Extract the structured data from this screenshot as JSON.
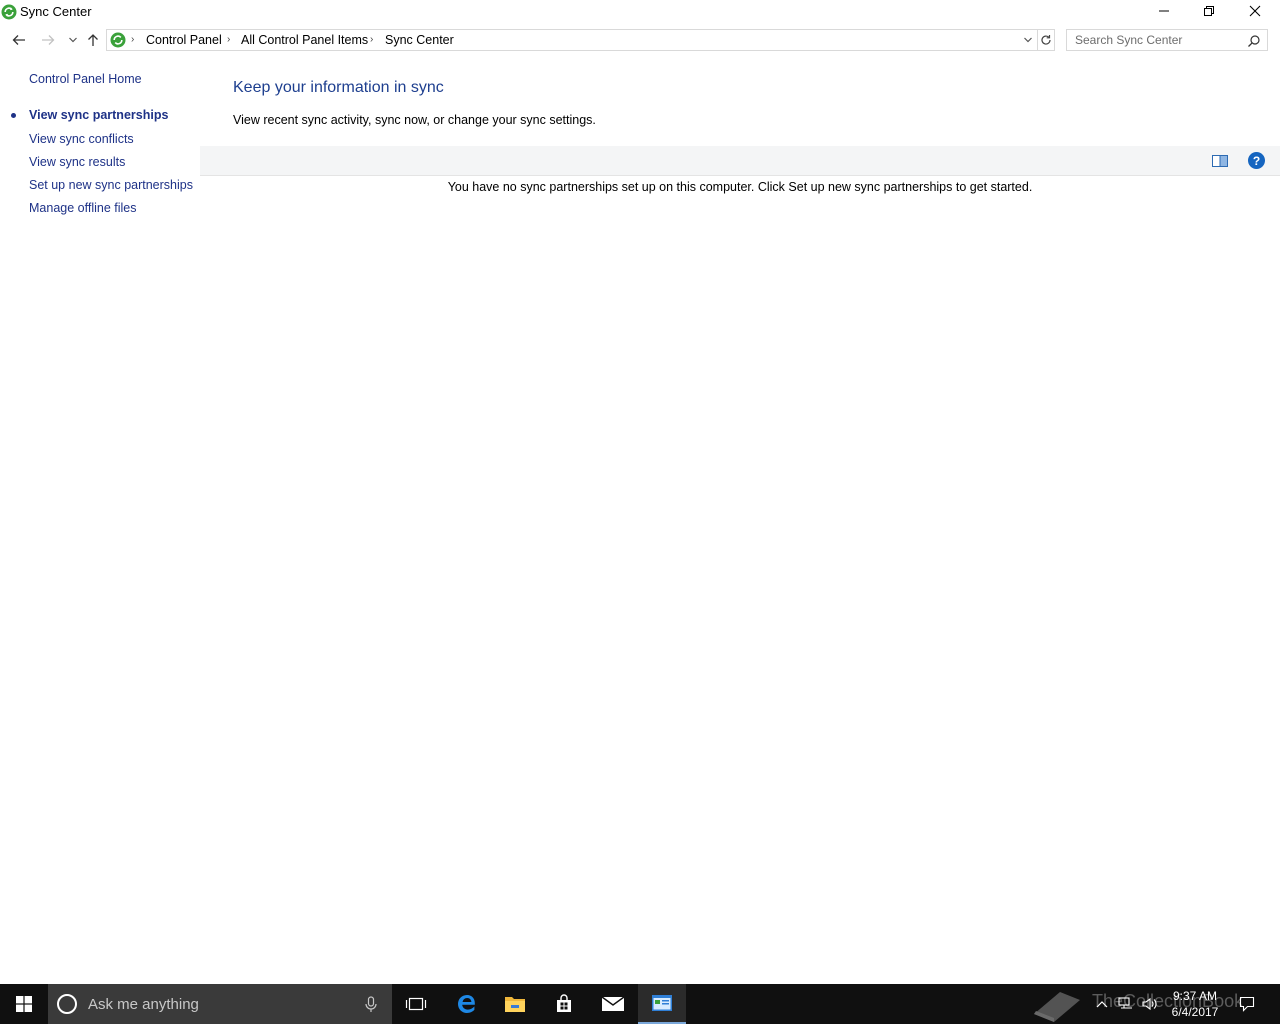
{
  "window": {
    "title": "Sync Center",
    "controls": {
      "minimize": "minimize-icon",
      "maximize": "restore-icon",
      "close": "close-icon"
    }
  },
  "address": {
    "breadcrumbs": [
      "Control Panel",
      "All Control Panel Items",
      "Sync Center"
    ],
    "search_placeholder": "Search Sync Center"
  },
  "sidebar": {
    "home": "Control Panel Home",
    "items": [
      {
        "label": "View sync partnerships",
        "active": true
      },
      {
        "label": "View sync conflicts",
        "active": false
      },
      {
        "label": "View sync results",
        "active": false
      },
      {
        "label": "Set up new sync partnerships",
        "active": false
      },
      {
        "label": "Manage offline files",
        "active": false
      }
    ]
  },
  "main": {
    "heading": "Keep your information in sync",
    "subtext": "View recent sync activity, sync now, or change your sync settings.",
    "help_label": "?",
    "empty_message": "You have no sync partnerships set up on this computer. Click Set up new sync partnerships to get started."
  },
  "taskbar": {
    "search_placeholder": "Ask me anything",
    "apps": [
      "task-view-icon",
      "edge-icon",
      "file-explorer-icon",
      "store-icon",
      "mail-icon",
      "control-panel-icon"
    ],
    "time": "9:37 AM",
    "date": "6/4/2017",
    "watermark": "TheCollectionBook"
  },
  "colors": {
    "link": "#1e3287",
    "heading": "#1e3f8f",
    "toolbar_bg": "#f4f5f6",
    "taskbar_bg": "#101010",
    "search_bg": "#3a3a3a",
    "help_blue": "#1565c0",
    "sync_green": "#3aa13a"
  }
}
